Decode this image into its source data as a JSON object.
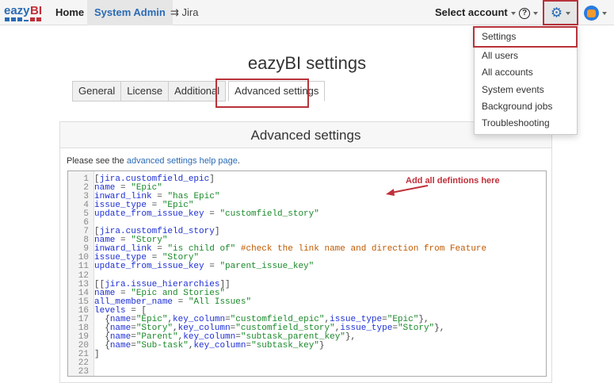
{
  "header": {
    "logo": "eazyBI",
    "nav": [
      {
        "label": "Home"
      },
      {
        "label": "System Admin"
      },
      {
        "label": "Jira"
      }
    ],
    "select_account": "Select account"
  },
  "page_title": "eazyBI settings",
  "tabs": [
    {
      "label": "General"
    },
    {
      "label": "License"
    },
    {
      "label": "Additional"
    },
    {
      "label": "Advanced settings"
    }
  ],
  "panel": {
    "title": "Advanced settings",
    "help_prefix": "Please see the ",
    "help_link": "advanced settings help page",
    "help_suffix": "."
  },
  "annotation": "Add all defintions here",
  "menu": [
    {
      "label": "Settings"
    },
    {
      "label": "All users"
    },
    {
      "label": "All accounts"
    },
    {
      "label": "System events"
    },
    {
      "label": "Background jobs"
    },
    {
      "label": "Troubleshooting"
    }
  ],
  "code": [
    [
      [
        "[",
        "k"
      ],
      [
        "jira.customfield_epic",
        "b"
      ],
      [
        "]",
        "k"
      ]
    ],
    [
      [
        "name",
        "b"
      ],
      [
        " = ",
        "k"
      ],
      [
        "\"Epic\"",
        "g"
      ]
    ],
    [
      [
        "inward_link",
        "b"
      ],
      [
        " = ",
        "k"
      ],
      [
        "\"has Epic\"",
        "g"
      ]
    ],
    [
      [
        "issue_type",
        "b"
      ],
      [
        " = ",
        "k"
      ],
      [
        "\"Epic\"",
        "g"
      ]
    ],
    [
      [
        "update_from_issue_key",
        "b"
      ],
      [
        " = ",
        "k"
      ],
      [
        "\"customfield_story\"",
        "g"
      ]
    ],
    [],
    [
      [
        "[",
        "k"
      ],
      [
        "jira.customfield_story",
        "b"
      ],
      [
        "]",
        "k"
      ]
    ],
    [
      [
        "name",
        "b"
      ],
      [
        " = ",
        "k"
      ],
      [
        "\"Story\"",
        "g"
      ]
    ],
    [
      [
        "inward_link",
        "b"
      ],
      [
        " = ",
        "k"
      ],
      [
        "\"is child of\"",
        "g"
      ],
      [
        " #check the link name and direction from Feature",
        "o"
      ]
    ],
    [
      [
        "issue_type",
        "b"
      ],
      [
        " = ",
        "k"
      ],
      [
        "\"Story\"",
        "g"
      ]
    ],
    [
      [
        "update_from_issue_key",
        "b"
      ],
      [
        " = ",
        "k"
      ],
      [
        "\"parent_issue_key\"",
        "g"
      ]
    ],
    [],
    [
      [
        "[[",
        "k"
      ],
      [
        "jira.issue_hierarchies",
        "b"
      ],
      [
        "]]",
        "k"
      ]
    ],
    [
      [
        "name",
        "b"
      ],
      [
        " = ",
        "k"
      ],
      [
        "\"Epic and Stories\"",
        "g"
      ]
    ],
    [
      [
        "all_member_name",
        "b"
      ],
      [
        " = ",
        "k"
      ],
      [
        "\"All Issues\"",
        "g"
      ]
    ],
    [
      [
        "levels",
        "b"
      ],
      [
        " = [",
        "k"
      ]
    ],
    [
      [
        "  {",
        "k"
      ],
      [
        "name",
        "b"
      ],
      [
        "=",
        "k"
      ],
      [
        "\"Epic\"",
        "g"
      ],
      [
        ",",
        "k"
      ],
      [
        "key_column",
        "b"
      ],
      [
        "=",
        "k"
      ],
      [
        "\"customfield_epic\"",
        "g"
      ],
      [
        ",",
        "k"
      ],
      [
        "issue_type",
        "b"
      ],
      [
        "=",
        "k"
      ],
      [
        "\"Epic\"",
        "g"
      ],
      [
        "},",
        "k"
      ]
    ],
    [
      [
        "  {",
        "k"
      ],
      [
        "name",
        "b"
      ],
      [
        "=",
        "k"
      ],
      [
        "\"Story\"",
        "g"
      ],
      [
        ",",
        "k"
      ],
      [
        "key_column",
        "b"
      ],
      [
        "=",
        "k"
      ],
      [
        "\"customfield_story\"",
        "g"
      ],
      [
        ",",
        "k"
      ],
      [
        "issue_type",
        "b"
      ],
      [
        "=",
        "k"
      ],
      [
        "\"Story\"",
        "g"
      ],
      [
        "},",
        "k"
      ]
    ],
    [
      [
        "  {",
        "k"
      ],
      [
        "name",
        "b"
      ],
      [
        "=",
        "k"
      ],
      [
        "\"Parent\"",
        "g"
      ],
      [
        ",",
        "k"
      ],
      [
        "key_column",
        "b"
      ],
      [
        "=",
        "k"
      ],
      [
        "\"subtask_parent_key\"",
        "g"
      ],
      [
        "},",
        "k"
      ]
    ],
    [
      [
        "  {",
        "k"
      ],
      [
        "name",
        "b"
      ],
      [
        "=",
        "k"
      ],
      [
        "\"Sub-task\"",
        "g"
      ],
      [
        ",",
        "k"
      ],
      [
        "key_column",
        "b"
      ],
      [
        "=",
        "k"
      ],
      [
        "\"subtask_key\"",
        "g"
      ],
      [
        "}",
        "k"
      ]
    ],
    [
      [
        "]",
        "k"
      ]
    ],
    [],
    []
  ],
  "colors": {
    "accent": "#2a6bb5",
    "highlight": "#b8333a"
  }
}
